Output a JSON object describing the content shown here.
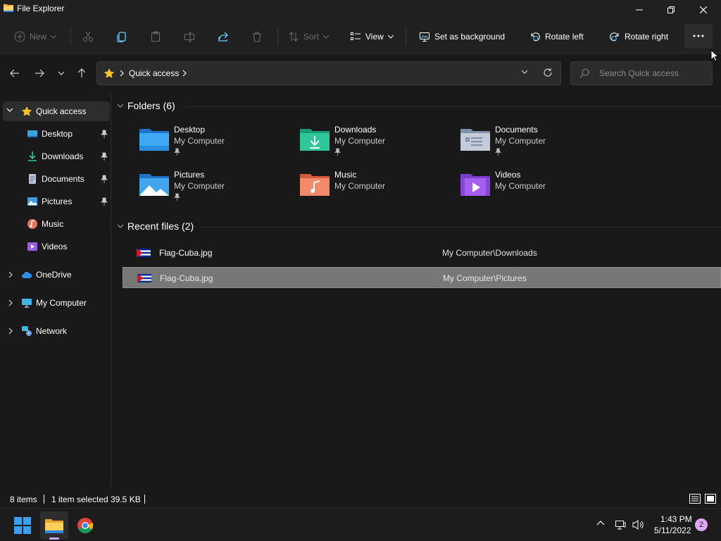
{
  "window": {
    "title": "File Explorer"
  },
  "commandbar": {
    "new_label": "New",
    "sort_label": "Sort",
    "view_label": "View",
    "set_background_label": "Set as background",
    "rotate_left_label": "Rotate left",
    "rotate_right_label": "Rotate right",
    "more_label": "..."
  },
  "address": {
    "location": "Quick access",
    "search_placeholder": "Search Quick access"
  },
  "nav": {
    "quick_access": "Quick access",
    "items": [
      {
        "label": "Desktop",
        "icon": "desktop-icon",
        "pinned": true
      },
      {
        "label": "Downloads",
        "icon": "downloads-icon",
        "pinned": true
      },
      {
        "label": "Documents",
        "icon": "documents-icon",
        "pinned": true
      },
      {
        "label": "Pictures",
        "icon": "pictures-icon",
        "pinned": true
      },
      {
        "label": "Music",
        "icon": "music-icon",
        "pinned": false
      },
      {
        "label": "Videos",
        "icon": "videos-icon",
        "pinned": false
      }
    ],
    "onedrive": "OneDrive",
    "my_computer": "My Computer",
    "network": "Network"
  },
  "folders": {
    "header": "Folders (6)",
    "items": [
      {
        "name": "Desktop",
        "location": "My Computer",
        "pinned": true,
        "icon": "desktop-folder-icon"
      },
      {
        "name": "Downloads",
        "location": "My Computer",
        "pinned": true,
        "icon": "downloads-folder-icon"
      },
      {
        "name": "Documents",
        "location": "My Computer",
        "pinned": true,
        "icon": "documents-folder-icon"
      },
      {
        "name": "Pictures",
        "location": "My Computer",
        "pinned": true,
        "icon": "pictures-folder-icon"
      },
      {
        "name": "Music",
        "location": "My Computer",
        "pinned": false,
        "icon": "music-folder-icon"
      },
      {
        "name": "Videos",
        "location": "My Computer",
        "pinned": false,
        "icon": "videos-folder-icon"
      }
    ]
  },
  "recent": {
    "header": "Recent files (2)",
    "files": [
      {
        "name": "Flag-Cuba.jpg",
        "path": "My Computer\\Downloads",
        "selected": false
      },
      {
        "name": "Flag-Cuba.jpg",
        "path": "My Computer\\Pictures",
        "selected": true
      }
    ]
  },
  "status": {
    "items": "8 items",
    "selected": "1 item selected",
    "size": "39.5 KB"
  },
  "taskbar": {
    "time": "1:43 PM",
    "date": "5/11/2022",
    "notifications": "2"
  },
  "colors": {
    "background": "#191919",
    "chrome": "#202020",
    "selection": "#777777",
    "accent": "#60cdff"
  }
}
